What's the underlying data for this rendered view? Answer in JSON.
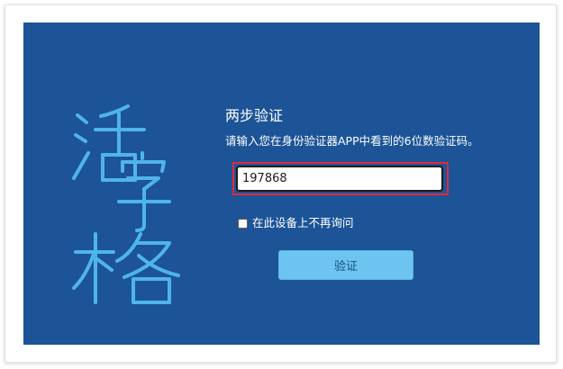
{
  "logo": {
    "text": "活字格",
    "color": "#4fb4ea"
  },
  "form": {
    "title": "两步验证",
    "instructions": "请输入您在身份验证器APP中看到的6位数验证码。",
    "code_value": "197868",
    "remember_label": "在此设备上不再询问",
    "remember_checked": false,
    "verify_label": "验证"
  },
  "colors": {
    "panel_background": "#1c5497",
    "highlight_border": "#e02a3a",
    "button_background": "#6dc4f1"
  }
}
